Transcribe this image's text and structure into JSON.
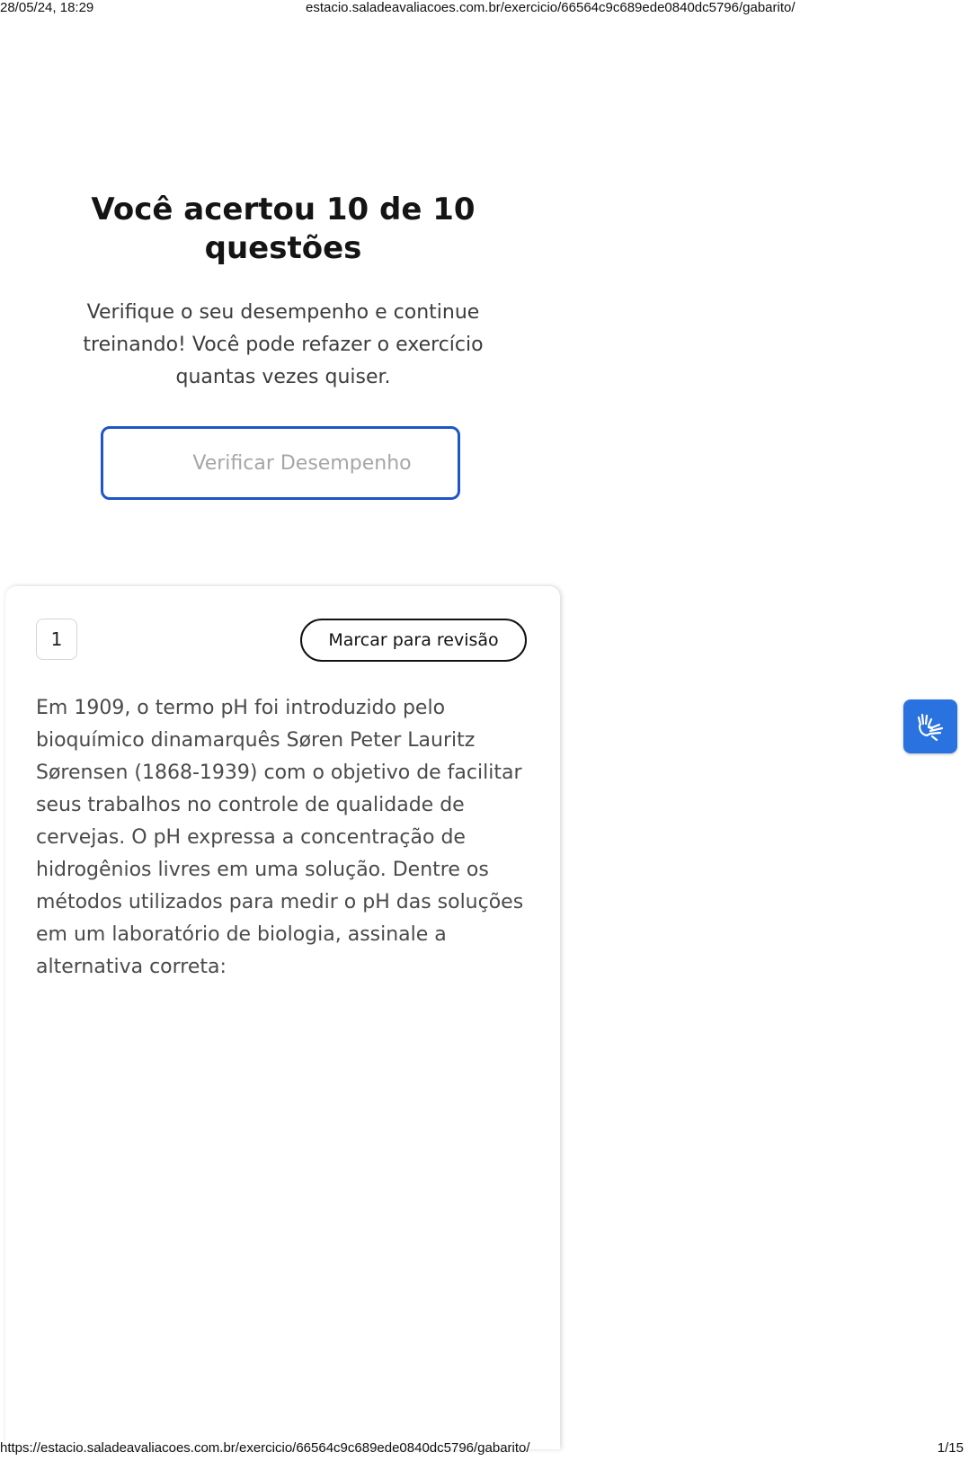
{
  "print_header": {
    "date": "28/05/24, 18:29",
    "title": "estacio.saladeavaliacoes.com.br/exercicio/66564c9c689ede0840dc5796/gabarito/"
  },
  "result": {
    "title": "Você acertou 10 de 10 questões",
    "subtitle": "Verifique o seu desempenho e continue treinando! Você pode refazer o exercício quantas vezes quiser.",
    "verify_button_label": "Verificar Desempenho"
  },
  "question": {
    "number": "1",
    "review_button_label": "Marcar para revisão",
    "text": "Em 1909, o termo pH foi introduzido pelo bioquímico dinamarquês Søren Peter Lauritz Sørensen (1868-1939) com o objetivo de facilitar seus trabalhos no controle de qualidade de cervejas. O pH expressa a concentração de hidrogênios livres em uma solução. Dentre os métodos utilizados para medir o pH das soluções em um laboratório de biologia, assinale a alternativa correta:"
  },
  "accessibility_widget": {
    "icon": "sign-language-hands-icon",
    "color": "#2a72e0"
  },
  "print_footer": {
    "url": "https://estacio.saladeavaliacoes.com.br/exercicio/66564c9c689ede0840dc5796/gabarito/",
    "page": "1/15"
  },
  "colors": {
    "primary_blue": "#1f55c8",
    "text_dark": "#141414",
    "text_body": "#4a4a4a",
    "button_disabled_text": "#a6a6a6"
  }
}
